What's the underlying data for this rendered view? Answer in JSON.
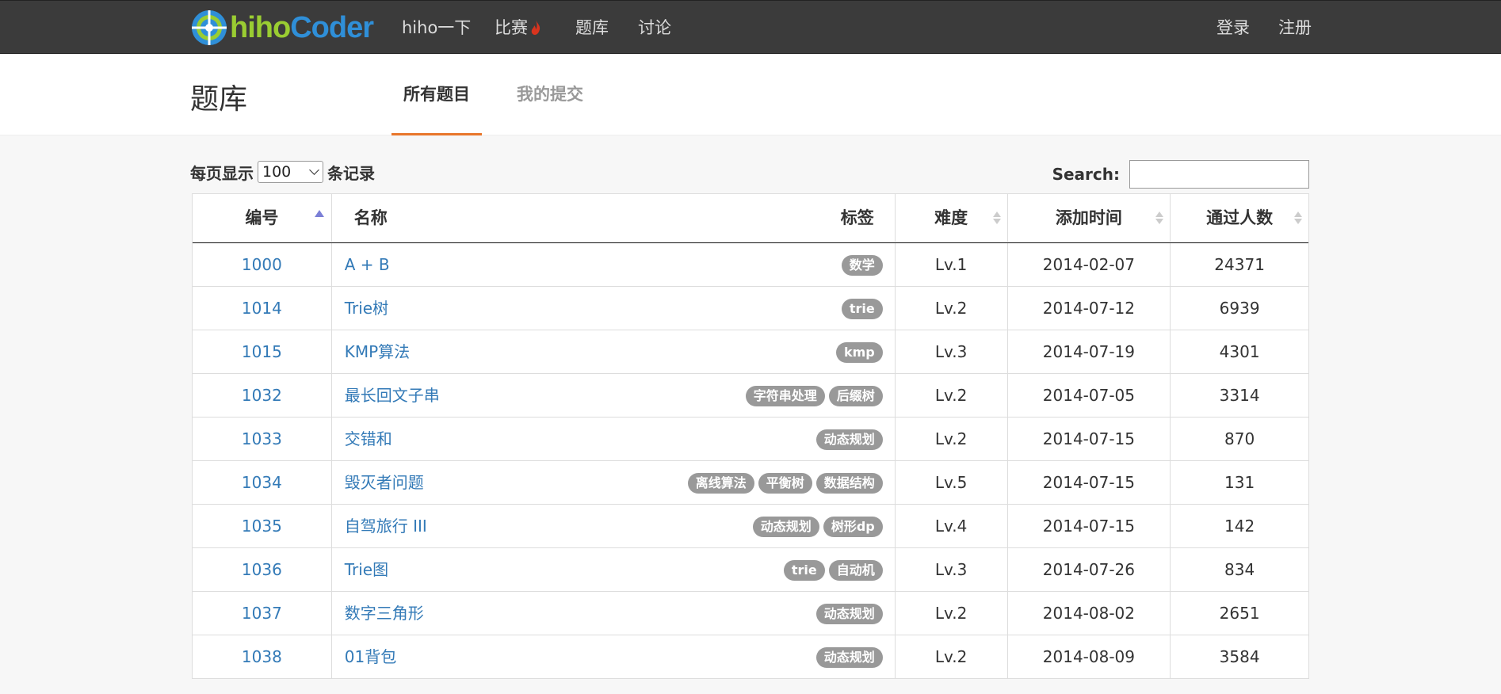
{
  "nav": {
    "brand_hiho": "hiho",
    "brand_coder": "Coder",
    "items": [
      "hiho一下",
      "比赛",
      "题库",
      "讨论"
    ],
    "login": "登录",
    "register": "注册"
  },
  "page": {
    "title": "题库",
    "tabs": [
      "所有题目",
      "我的提交"
    ]
  },
  "controls": {
    "length_prefix": "每页显示",
    "length_value": "100",
    "length_suffix": "条记录",
    "search_label": "Search:",
    "search_value": ""
  },
  "table": {
    "headers": {
      "id": "编号",
      "name": "名称",
      "tags": "标签",
      "level": "难度",
      "date": "添加时间",
      "passed": "通过人数"
    },
    "rows": [
      {
        "id": "1000",
        "name": "A + B",
        "tags": [
          "数学"
        ],
        "level": "Lv.1",
        "date": "2014-02-07",
        "passed": "24371"
      },
      {
        "id": "1014",
        "name": "Trie树",
        "tags": [
          "trie"
        ],
        "level": "Lv.2",
        "date": "2014-07-12",
        "passed": "6939"
      },
      {
        "id": "1015",
        "name": "KMP算法",
        "tags": [
          "kmp"
        ],
        "level": "Lv.3",
        "date": "2014-07-19",
        "passed": "4301"
      },
      {
        "id": "1032",
        "name": "最长回文子串",
        "tags": [
          "字符串处理",
          "后缀树"
        ],
        "level": "Lv.2",
        "date": "2014-07-05",
        "passed": "3314"
      },
      {
        "id": "1033",
        "name": "交错和",
        "tags": [
          "动态规划"
        ],
        "level": "Lv.2",
        "date": "2014-07-15",
        "passed": "870"
      },
      {
        "id": "1034",
        "name": "毁灭者问题",
        "tags": [
          "离线算法",
          "平衡树",
          "数据结构"
        ],
        "level": "Lv.5",
        "date": "2014-07-15",
        "passed": "131"
      },
      {
        "id": "1035",
        "name": "自驾旅行 III",
        "tags": [
          "动态规划",
          "树形dp"
        ],
        "level": "Lv.4",
        "date": "2014-07-15",
        "passed": "142"
      },
      {
        "id": "1036",
        "name": "Trie图",
        "tags": [
          "trie",
          "自动机"
        ],
        "level": "Lv.3",
        "date": "2014-07-26",
        "passed": "834"
      },
      {
        "id": "1037",
        "name": "数字三角形",
        "tags": [
          "动态规划"
        ],
        "level": "Lv.2",
        "date": "2014-08-02",
        "passed": "2651"
      },
      {
        "id": "1038",
        "name": "01背包",
        "tags": [
          "动态规划"
        ],
        "level": "Lv.2",
        "date": "2014-08-09",
        "passed": "3584"
      }
    ]
  },
  "colors": {
    "navbar": "#3b3b3b",
    "link": "#337ab7",
    "tab_accent": "#e8762b",
    "tag": "#999999",
    "brand_hiho": "#9acd32",
    "brand_coder": "#2f8fd8"
  }
}
